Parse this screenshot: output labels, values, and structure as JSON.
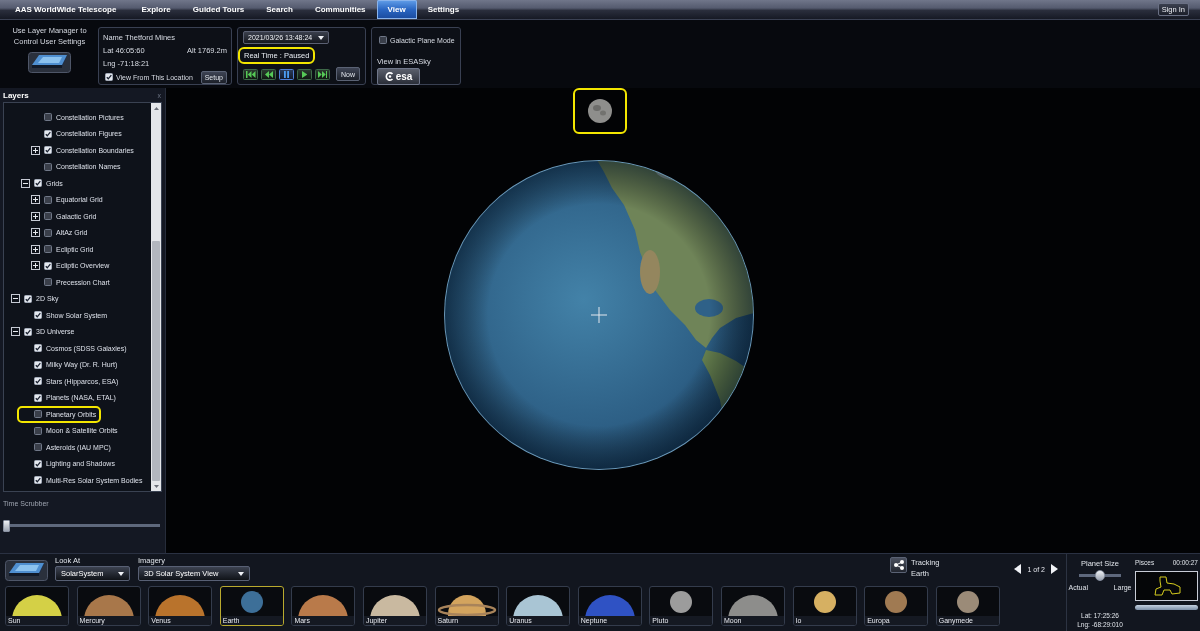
{
  "menu_bar": {
    "app_menu": "AAS WorldWide Telescope",
    "tabs": [
      {
        "label": "Explore",
        "selected": false
      },
      {
        "label": "Guided Tours",
        "selected": false
      },
      {
        "label": "Search",
        "selected": false
      },
      {
        "label": "Communities",
        "selected": false
      },
      {
        "label": "View",
        "selected": true
      },
      {
        "label": "Settings",
        "selected": false
      }
    ],
    "sign_in": "Sign In"
  },
  "view_ribbon": {
    "layer_manager_note": "Use Layer Manager to Control User Settings",
    "location": {
      "name": "Name Thetford Mines",
      "lat": "Lat 46:05:60",
      "alt": "Alt 1769.2m",
      "lng": "Lng -71:18:21",
      "view_from_location": {
        "label": "View From This Location",
        "checked": true
      },
      "setup_button": "Setup"
    },
    "time": {
      "datetime": "2021/03/26 13:48:24",
      "status": {
        "text": "Real Time : Paused",
        "highlighted": true
      },
      "controls": [
        {
          "kind": "first",
          "selected": false
        },
        {
          "kind": "rewind",
          "selected": false
        },
        {
          "kind": "pause",
          "selected": true
        },
        {
          "kind": "play",
          "selected": false
        },
        {
          "kind": "last",
          "selected": false
        }
      ],
      "now_button": "Now"
    },
    "esasky": {
      "galactic_plane_mode": {
        "label": "Galactic Plane Mode",
        "checked": false
      },
      "label": "View in ESASky",
      "logo_button": "esa"
    }
  },
  "layers": {
    "title": "Layers",
    "close": "x",
    "tree": [
      {
        "children": [
          {
            "children": [
              {
                "label": "Constellation Pictures",
                "checked": false,
                "highlighted": false
              },
              {
                "label": "Constellation Figures",
                "checked": true,
                "highlighted": false
              },
              {
                "label": "Constellation Boundaries",
                "checked": true,
                "expanded": false,
                "highlighted": false
              },
              {
                "label": "Constellation Names",
                "checked": false,
                "highlighted": false
              }
            ]
          },
          {
            "label": "Grids",
            "checked": true,
            "expanded": true,
            "highlighted": false,
            "children": [
              {
                "label": "Equatorial Grid",
                "checked": false,
                "expanded": false,
                "highlighted": false
              },
              {
                "label": "Galactic Grid",
                "checked": false,
                "expanded": false,
                "highlighted": false
              },
              {
                "label": "AltAz Grid",
                "checked": false,
                "expanded": false,
                "highlighted": false
              },
              {
                "label": "Ecliptic Grid",
                "checked": false,
                "expanded": false,
                "highlighted": false
              },
              {
                "label": "Ecliptic Overview",
                "checked": true,
                "expanded": false,
                "highlighted": false
              },
              {
                "label": "Precession Chart",
                "checked": false,
                "highlighted": false
              }
            ]
          }
        ]
      },
      {
        "label": "2D Sky",
        "checked": true,
        "expanded": true,
        "highlighted": false,
        "children": [
          {
            "label": "Show Solar System",
            "checked": true,
            "highlighted": false
          }
        ]
      },
      {
        "label": "3D Universe",
        "checked": true,
        "expanded": true,
        "highlighted": false,
        "children": [
          {
            "label": "Cosmos (SDSS Galaxies)",
            "checked": true,
            "highlighted": false
          },
          {
            "label": "Milky Way (Dr. R. Hurt)",
            "checked": true,
            "highlighted": false
          },
          {
            "label": "Stars (Hipparcos, ESA)",
            "checked": true,
            "highlighted": false
          },
          {
            "label": "Planets (NASA, ETAL)",
            "checked": true,
            "highlighted": false
          },
          {
            "label": "Planetary Orbits",
            "checked": false,
            "highlighted": true
          },
          {
            "label": "Moon & Satellite Orbits",
            "checked": false,
            "highlighted": false
          },
          {
            "label": "Asteroids (IAU MPC)",
            "checked": false,
            "highlighted": false
          },
          {
            "label": "Lighting and Shadows",
            "checked": true,
            "highlighted": false
          },
          {
            "label": "Multi-Res Solar System Bodies",
            "checked": true,
            "highlighted": false
          }
        ]
      }
    ],
    "time_scrubber": {
      "label": "Time Scrubber",
      "level": 0
    }
  },
  "sky_view": {
    "moon": {
      "highlighted": true
    }
  },
  "bottom_bar": {
    "look_at": {
      "label": "Look At",
      "value": "SolarSystem"
    },
    "imagery": {
      "label": "Imagery",
      "value": "3D Solar System View"
    },
    "tracking": {
      "label": "Tracking",
      "target": "Earth"
    },
    "pager": "1 of 2",
    "thumbnails": [
      {
        "label": "Sun",
        "kind": "large",
        "color": "#d4d046",
        "selected": false
      },
      {
        "label": "Mercury",
        "kind": "large",
        "color": "#a8774a",
        "selected": false
      },
      {
        "label": "Venus",
        "kind": "large",
        "color": "#b9732c",
        "selected": false
      },
      {
        "label": "Earth",
        "kind": "small",
        "color": "#3d6f98",
        "selected": true
      },
      {
        "label": "Mars",
        "kind": "large",
        "color": "#b97a4a",
        "selected": false
      },
      {
        "label": "Jupiter",
        "kind": "large",
        "color": "#c9b9a0",
        "selected": false
      },
      {
        "label": "Saturn",
        "kind": "ringed",
        "color": "#d3a45e",
        "selected": false
      },
      {
        "label": "Uranus",
        "kind": "large",
        "color": "#a9c5d4",
        "selected": false
      },
      {
        "label": "Neptune",
        "kind": "large",
        "color": "#2f52c4",
        "selected": false
      },
      {
        "label": "Pluto",
        "kind": "small",
        "color": "#9c9c9c",
        "selected": false
      },
      {
        "label": "Moon",
        "kind": "large",
        "color": "#8d8d8b",
        "selected": false
      },
      {
        "label": "Io",
        "kind": "small",
        "color": "#d6b062",
        "selected": false
      },
      {
        "label": "Europa",
        "kind": "small",
        "color": "#a07a52",
        "selected": false
      },
      {
        "label": "Ganymede",
        "kind": "small",
        "color": "#9b8b78",
        "selected": false
      }
    ],
    "planet_size": {
      "label": "Planet Size",
      "level": 0.5,
      "min_label": "Actual",
      "max_label": "Large"
    },
    "coordinates": {
      "lat": "Lat: 17:25:26",
      "lng": "Lng: -68:29:010"
    },
    "constellation": {
      "name": "Pisces",
      "time": "00:00:27"
    }
  }
}
